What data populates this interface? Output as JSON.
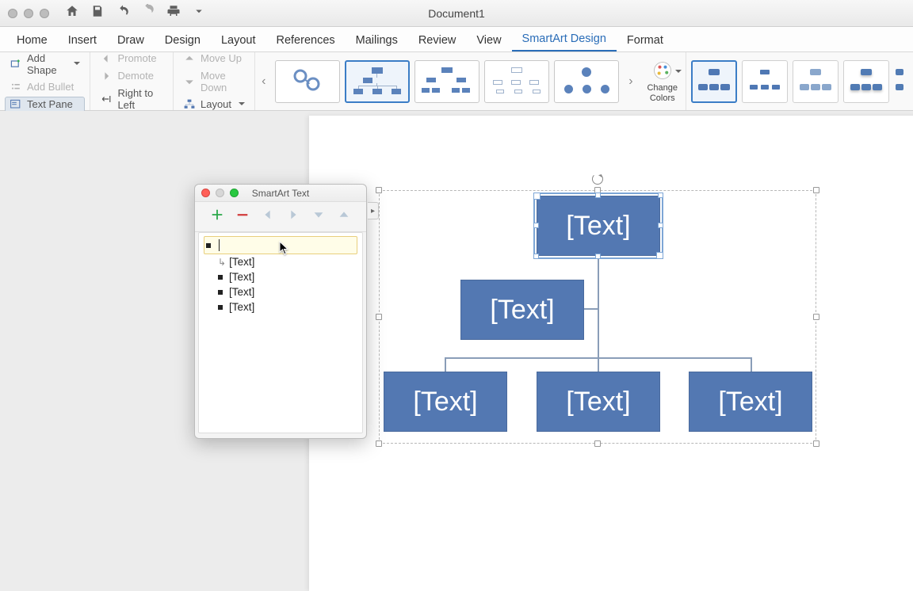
{
  "window": {
    "title": "Document1"
  },
  "tabs": {
    "home": "Home",
    "insert": "Insert",
    "draw": "Draw",
    "design": "Design",
    "layout": "Layout",
    "references": "References",
    "mailings": "Mailings",
    "review": "Review",
    "view": "View",
    "smartart": "SmartArt Design",
    "format": "Format"
  },
  "ribbon": {
    "add_shape": "Add Shape",
    "add_bullet": "Add Bullet",
    "text_pane": "Text Pane",
    "promote": "Promote",
    "demote": "Demote",
    "right_to_left": "Right to Left",
    "move_up": "Move Up",
    "move_down": "Move Down",
    "layout": "Layout",
    "change_colors": "Change\nColors"
  },
  "text_pane": {
    "title": "SmartArt Text",
    "items": [
      "",
      "[Text]",
      "[Text]",
      "[Text]",
      "[Text]"
    ]
  },
  "smartart": {
    "nodes": {
      "top": "[Text]",
      "assistant": "[Text]",
      "child1": "[Text]",
      "child2": "[Text]",
      "child3": "[Text]"
    }
  },
  "colors": {
    "node_fill": "#5378b2",
    "accent": "#2a6db8"
  }
}
